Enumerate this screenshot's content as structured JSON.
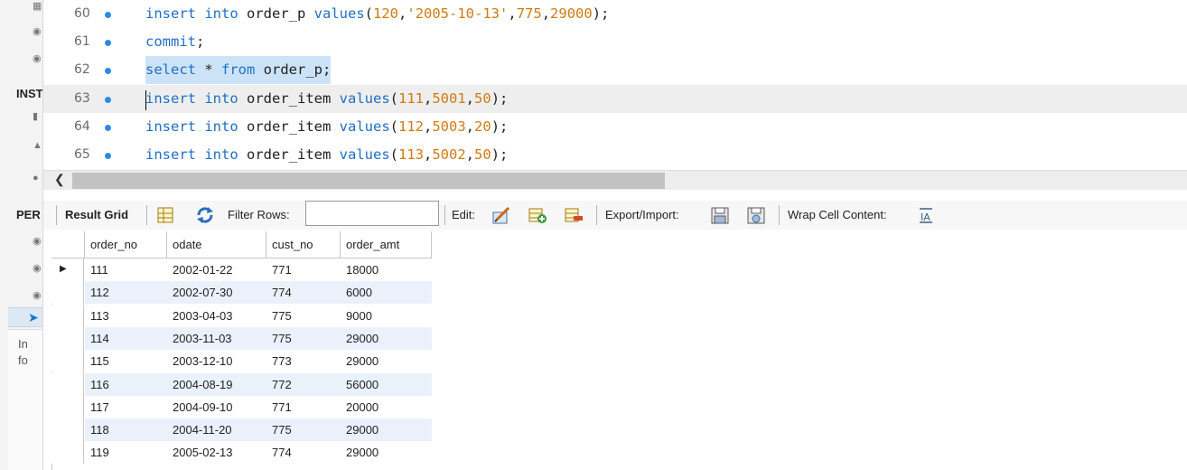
{
  "sidebar": {
    "section_instance": "INST",
    "section_performance": "PER",
    "info_text_1": "In",
    "info_text_2": "fo"
  },
  "editor": {
    "lines": [
      {
        "no": "60",
        "tokens": [
          [
            "kw",
            "insert"
          ],
          [
            "p",
            " "
          ],
          [
            "kw",
            "into"
          ],
          [
            "p",
            " order_p "
          ],
          [
            "kw",
            "values"
          ],
          [
            "p",
            "("
          ],
          [
            "num",
            "120"
          ],
          [
            "p",
            ","
          ],
          [
            "str",
            "'2005-10-13'"
          ],
          [
            "p",
            ","
          ],
          [
            "num",
            "775"
          ],
          [
            "p",
            ","
          ],
          [
            "num",
            "29000"
          ],
          [
            "p",
            ");"
          ]
        ]
      },
      {
        "no": "61",
        "tokens": [
          [
            "kw",
            "commit"
          ],
          [
            "p",
            ";"
          ]
        ]
      },
      {
        "no": "62",
        "tokens": [
          [
            "kw",
            "select"
          ],
          [
            "p",
            " * "
          ],
          [
            "kw",
            "from"
          ],
          [
            "p",
            " order_p;"
          ]
        ]
      },
      {
        "no": "63",
        "tokens": [
          [
            "kw",
            "insert"
          ],
          [
            "p",
            " "
          ],
          [
            "kw",
            "into"
          ],
          [
            "p",
            " order_item "
          ],
          [
            "kw",
            "values"
          ],
          [
            "p",
            "("
          ],
          [
            "num",
            "111"
          ],
          [
            "p",
            ","
          ],
          [
            "num",
            "5001"
          ],
          [
            "p",
            ","
          ],
          [
            "num",
            "50"
          ],
          [
            "p",
            ");"
          ]
        ]
      },
      {
        "no": "64",
        "tokens": [
          [
            "kw",
            "insert"
          ],
          [
            "p",
            " "
          ],
          [
            "kw",
            "into"
          ],
          [
            "p",
            " order_item "
          ],
          [
            "kw",
            "values"
          ],
          [
            "p",
            "("
          ],
          [
            "num",
            "112"
          ],
          [
            "p",
            ","
          ],
          [
            "num",
            "5003"
          ],
          [
            "p",
            ","
          ],
          [
            "num",
            "20"
          ],
          [
            "p",
            ");"
          ]
        ]
      },
      {
        "no": "65",
        "tokens": [
          [
            "kw",
            "insert"
          ],
          [
            "p",
            " "
          ],
          [
            "kw",
            "into"
          ],
          [
            "p",
            " order_item "
          ],
          [
            "kw",
            "values"
          ],
          [
            "p",
            "("
          ],
          [
            "num",
            "113"
          ],
          [
            "p",
            ","
          ],
          [
            "num",
            "5002"
          ],
          [
            "p",
            ","
          ],
          [
            "num",
            "50"
          ],
          [
            "p",
            ");"
          ]
        ]
      }
    ]
  },
  "toolbar": {
    "result_grid_label": "Result Grid",
    "filter_rows_label": "Filter Rows:",
    "filter_value": "",
    "edit_label": "Edit:",
    "export_import_label": "Export/Import:",
    "wrap_cell_label": "Wrap Cell Content:"
  },
  "grid": {
    "columns": [
      "order_no",
      "odate",
      "cust_no",
      "order_amt"
    ],
    "rows": [
      [
        "111",
        "2002-01-22",
        "771",
        "18000"
      ],
      [
        "112",
        "2002-07-30",
        "774",
        "6000"
      ],
      [
        "113",
        "2003-04-03",
        "775",
        "9000"
      ],
      [
        "114",
        "2003-11-03",
        "775",
        "29000"
      ],
      [
        "115",
        "2003-12-10",
        "773",
        "29000"
      ],
      [
        "116",
        "2004-08-19",
        "772",
        "56000"
      ],
      [
        "117",
        "2004-09-10",
        "771",
        "20000"
      ],
      [
        "118",
        "2004-11-20",
        "775",
        "29000"
      ],
      [
        "119",
        "2005-02-13",
        "774",
        "29000"
      ]
    ]
  },
  "colors": {
    "keyword": "#1f6fc5",
    "number": "#d07a12",
    "selection": "#cce3f7",
    "alt_row": "#eaf1fb"
  }
}
